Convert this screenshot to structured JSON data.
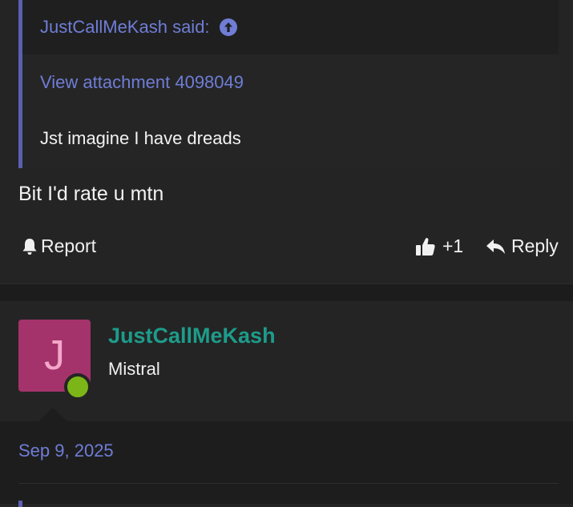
{
  "quote": {
    "attribution": "JustCallMeKash said:",
    "attachment_link": "View attachment 4098049",
    "text": "Jst imagine I have dreads"
  },
  "message": {
    "text": "Bit I'd rate u mtn"
  },
  "actions": {
    "report_label": "Report",
    "like_count": "+1",
    "reply_label": "Reply"
  },
  "next_post": {
    "avatar_letter": "J",
    "username": "JustCallMeKash",
    "user_title": "Mistral",
    "date": "Sep 9, 2025"
  },
  "colors": {
    "accent_link": "#6f7dd6",
    "username": "#1d9c8b",
    "avatar_bg": "#a4336b",
    "online": "#7cb518"
  },
  "icons": {
    "quote_arrow": "arrow-up-circle-icon",
    "report": "bell-icon",
    "like": "thumbs-up-icon",
    "reply": "reply-arrow-icon"
  }
}
